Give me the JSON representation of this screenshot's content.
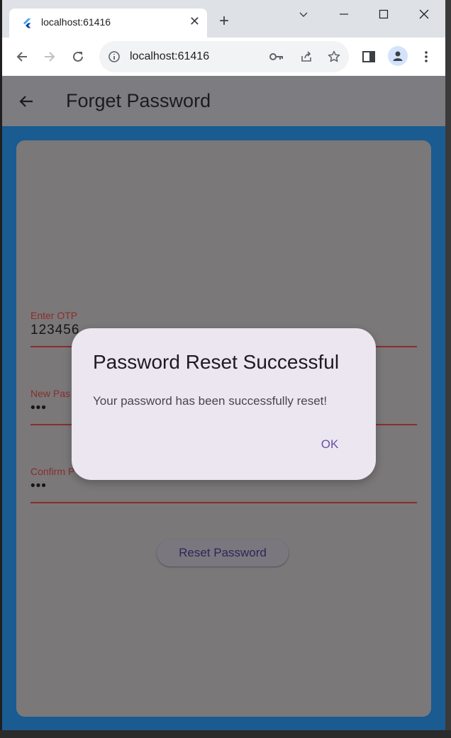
{
  "browser": {
    "tab_title": "localhost:61416",
    "tab_icon": "flutter-icon",
    "url": "localhost:61416",
    "new_tab_label": "+",
    "close_tab_label": "✕"
  },
  "app": {
    "title": "Forget Password",
    "fields": [
      {
        "label": "Enter OTP",
        "value": "123456"
      },
      {
        "label": "New Pas",
        "value": "•••"
      },
      {
        "label": "Confirm P",
        "value": "•••"
      }
    ],
    "reset_button": "Reset Password"
  },
  "dialog": {
    "title": "Password Reset Successful",
    "message": "Your password has been successfully reset!",
    "ok_label": "OK"
  },
  "colors": {
    "accent": "#6750a4",
    "appbar": "#7d7c81",
    "background": "#1a5b91",
    "field_underline": "#8a2d2d",
    "dialog_bg": "#ece6f0"
  }
}
